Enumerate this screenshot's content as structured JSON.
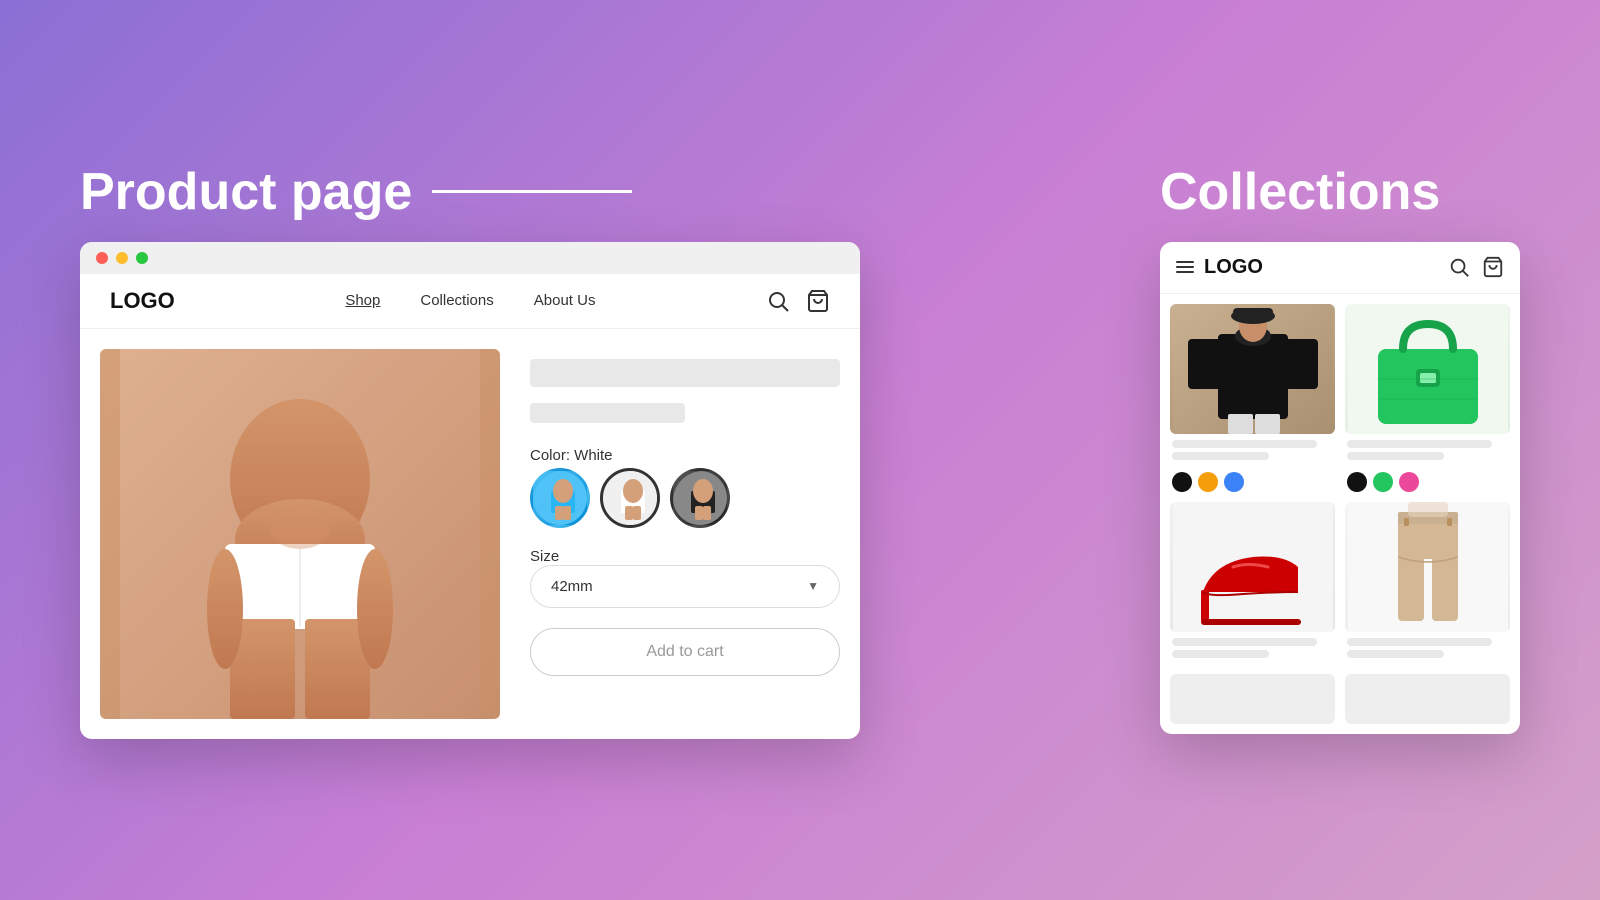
{
  "background": {
    "gradient": "linear-gradient(135deg, #8b6fd4, #c87fd4, #d4a0c8)"
  },
  "left_section": {
    "title": "Product page",
    "line": true
  },
  "right_section": {
    "title": "Collections"
  },
  "browser": {
    "dots": [
      "red",
      "yellow",
      "green"
    ],
    "nav": {
      "logo": "LOGO",
      "links": [
        {
          "label": "Shop",
          "active": true
        },
        {
          "label": "Collections",
          "active": false
        },
        {
          "label": "About Us",
          "active": false
        }
      ]
    },
    "product": {
      "color_label": "Color: White",
      "swatches": [
        "blue",
        "white",
        "black"
      ],
      "selected_swatch": "white",
      "size_label": "Size",
      "size_value": "42mm",
      "add_to_cart": "Add to cart"
    }
  },
  "collections": {
    "nav": {
      "logo": "LOGO"
    },
    "items": [
      {
        "type": "black-sweater",
        "colors": [
          "#111111",
          "#f59e0b",
          "#3b82f6"
        ]
      },
      {
        "type": "green-bag",
        "colors": [
          "#111111",
          "#22c55e",
          "#ec4899"
        ]
      },
      {
        "type": "red-heels",
        "colors": []
      },
      {
        "type": "beige-pants",
        "colors": []
      }
    ]
  }
}
